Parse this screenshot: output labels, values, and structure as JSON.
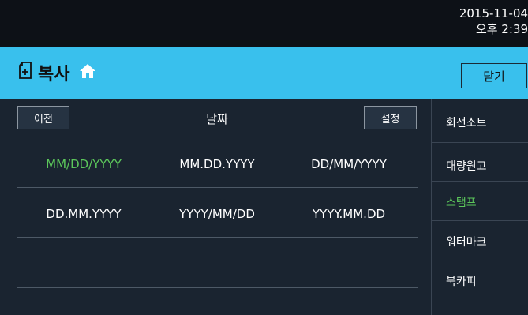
{
  "status": {
    "date": "2015-11-04",
    "time": "오후 2:39"
  },
  "header": {
    "title": "복사",
    "close_label": "닫기",
    "colors": {
      "bar": "#39c0ed"
    }
  },
  "toolbar": {
    "prev_label": "이전",
    "column_title": "날짜",
    "settings_label": "설정"
  },
  "date_formats": {
    "selected": "MM/DD/YYYY",
    "rows": [
      [
        "MM/DD/YYYY",
        "MM.DD.YYYY",
        "DD/MM/YYYY"
      ],
      [
        "DD.MM.YYYY",
        "YYYY/MM/DD",
        "YYYY.MM.DD"
      ]
    ]
  },
  "sidebar": {
    "active": "스탬프",
    "items": [
      "회전소트",
      "대량원고",
      "스탬프",
      "워터마크",
      "북카피"
    ]
  },
  "icons": {
    "title": "copy-document-icon",
    "home": "home-icon"
  },
  "accent": "#5cc75b"
}
